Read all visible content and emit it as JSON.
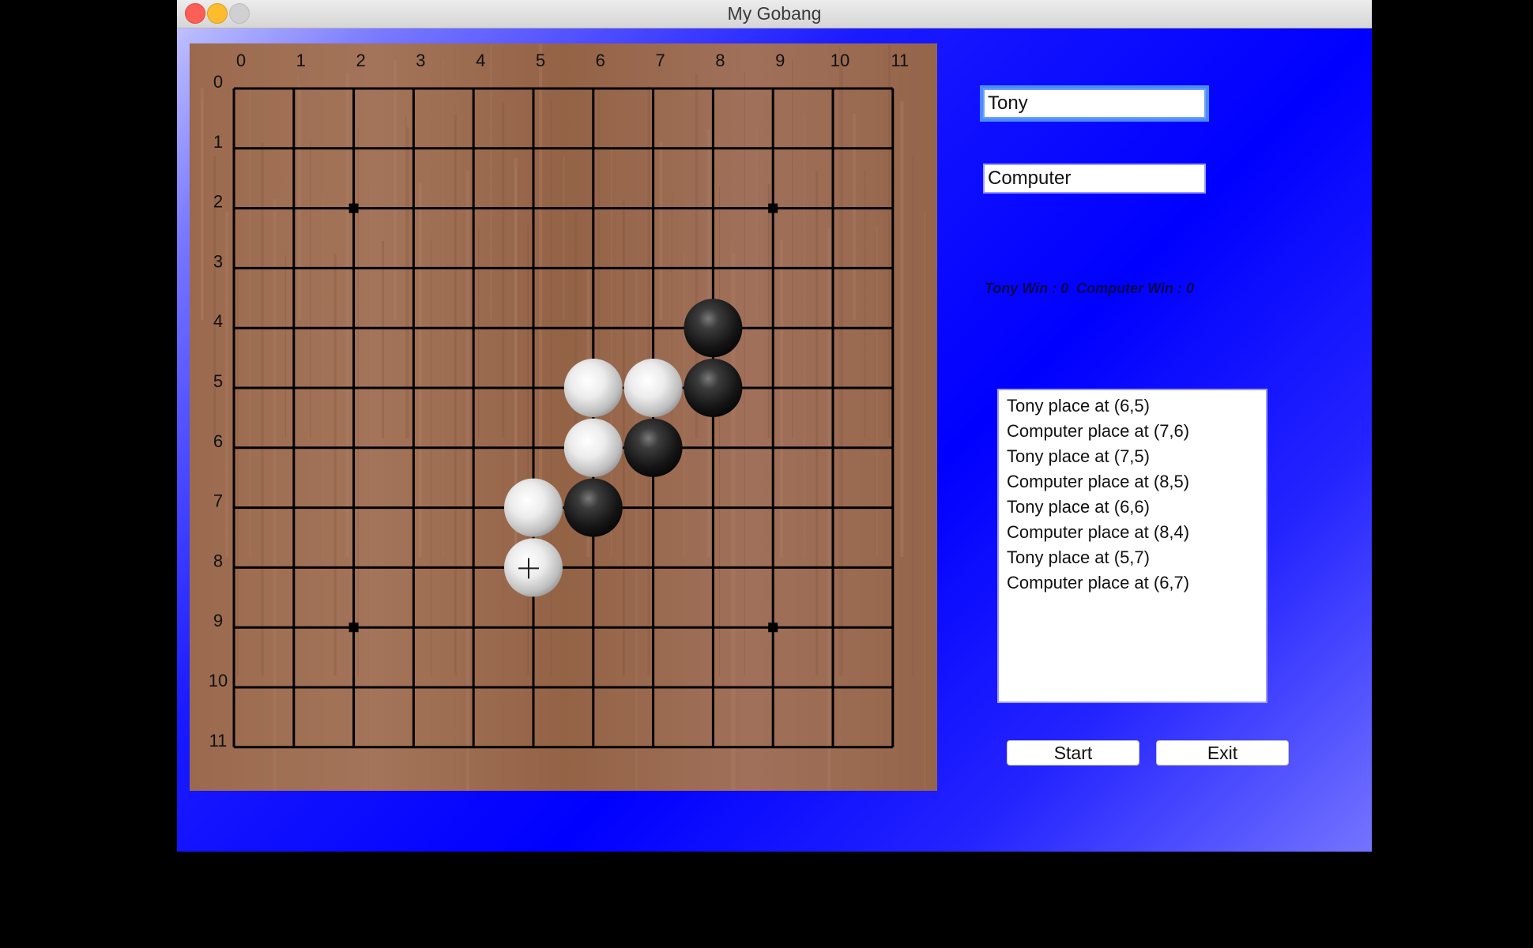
{
  "window": {
    "title": "My Gobang"
  },
  "board": {
    "size": 12,
    "col_labels": [
      "0",
      "1",
      "2",
      "3",
      "4",
      "5",
      "6",
      "7",
      "8",
      "9",
      "10",
      "11"
    ],
    "row_labels": [
      "0",
      "1",
      "2",
      "3",
      "4",
      "5",
      "6",
      "7",
      "8",
      "9",
      "10",
      "11"
    ],
    "star_points": [
      [
        2,
        2
      ],
      [
        9,
        2
      ],
      [
        2,
        9
      ],
      [
        9,
        9
      ]
    ],
    "stones": [
      {
        "x": 6,
        "y": 5,
        "color": "white"
      },
      {
        "x": 7,
        "y": 5,
        "color": "white"
      },
      {
        "x": 8,
        "y": 5,
        "color": "black"
      },
      {
        "x": 8,
        "y": 4,
        "color": "black"
      },
      {
        "x": 6,
        "y": 6,
        "color": "white"
      },
      {
        "x": 7,
        "y": 6,
        "color": "black"
      },
      {
        "x": 5,
        "y": 7,
        "color": "white"
      },
      {
        "x": 6,
        "y": 7,
        "color": "black"
      },
      {
        "x": 5,
        "y": 8,
        "color": "white"
      }
    ],
    "cursor": {
      "x": 5,
      "y": 8
    }
  },
  "players": {
    "player1_name": "Tony",
    "player2_name": "Computer"
  },
  "score_text": "Tony Win : 0  Computer Win : 0",
  "log": [
    "Tony place at (6,5)",
    "Computer place at (7,6)",
    "Tony place at (7,5)",
    "Computer place at (8,5)",
    "Tony place at (6,6)",
    "Computer place at (8,4)",
    "Tony place at (5,7)",
    "Computer place at (6,7)"
  ],
  "buttons": {
    "start": "Start",
    "exit": "Exit"
  },
  "colors": {
    "window_bg": "#0000ff",
    "board_wood": "#9a6a4d",
    "grid": "#000000"
  }
}
